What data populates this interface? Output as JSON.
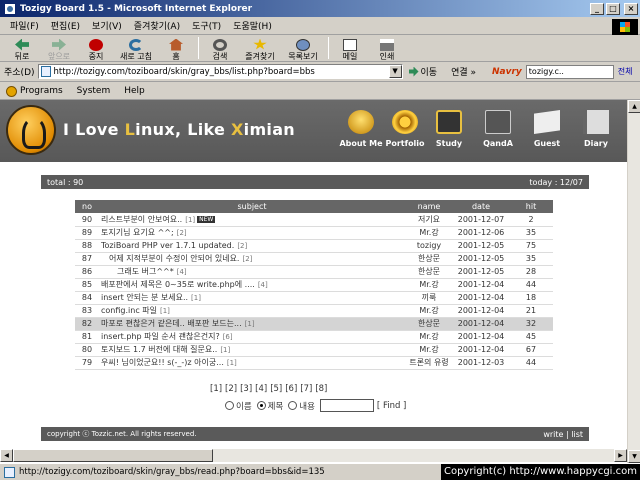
{
  "window": {
    "title": "Tozigy Board 1.5 - Microsoft Internet Explorer",
    "min": "_",
    "max": "□",
    "close": "×"
  },
  "menu": [
    "파일(F)",
    "편집(E)",
    "보기(V)",
    "즐겨찾기(A)",
    "도구(T)",
    "도움말(H)"
  ],
  "toolbar": {
    "back": "뒤로",
    "forward": "앞으로",
    "stop": "중지",
    "refresh": "새로 고침",
    "home": "홈",
    "search": "검색",
    "favorites": "즐겨찾기",
    "history": "목록보기",
    "mail": "메일",
    "print": "인쇄"
  },
  "address": {
    "label": "주소(D)",
    "url": "http://tozigy.com/toziboard/skin/gray_bbs/list.php?board=bbs",
    "go": "이동",
    "links": "연결 »",
    "naver_logo": "Navry",
    "naver_search": "tozigy.c..",
    "naver_all": "전체"
  },
  "linksbar": [
    "Programs",
    "System",
    "Help"
  ],
  "banner": {
    "title_parts": [
      "I Love ",
      "L",
      "inux, Like ",
      "X",
      "imian"
    ],
    "nav": [
      "About Me",
      "Portfolio",
      "Study",
      "QandA",
      "Guest",
      "Diary"
    ]
  },
  "board": {
    "total": "total : 90",
    "today": "today : 12/07",
    "headers": [
      "no",
      "subject",
      "name",
      "date",
      "hit"
    ],
    "rows": [
      {
        "no": "90",
        "subject": "리스트부분이 안보여요..",
        "cmt": "[1]",
        "new": "NEW",
        "name": "저기요",
        "date": "2001-12-07",
        "hit": "2"
      },
      {
        "no": "89",
        "subject": "토지기님 요기요 ^^;",
        "cmt": "[2]",
        "name": "Mr.강",
        "date": "2001-12-06",
        "hit": "35"
      },
      {
        "no": "88",
        "subject": "ToziBoard PHP ver 1.7.1 updated.",
        "cmt": "[2]",
        "name": "tozigy",
        "date": "2001-12-05",
        "hit": "75"
      },
      {
        "no": "87",
        "subject": "어제 지적부분이 수정이 안되어 있네요.",
        "cmt": "[2]",
        "indent": 1,
        "name": "한상문",
        "date": "2001-12-05",
        "hit": "35"
      },
      {
        "no": "86",
        "subject": "그래도 버그^^*",
        "cmt": "[4]",
        "indent": 2,
        "name": "한상문",
        "date": "2001-12-05",
        "hit": "28"
      },
      {
        "no": "85",
        "subject": "배포판에서 제목은 0~35로 write.php에 ....",
        "cmt": "[4]",
        "name": "Mr.강",
        "date": "2001-12-04",
        "hit": "44"
      },
      {
        "no": "84",
        "subject": "insert 안되는 분 보세요..",
        "cmt": "[1]",
        "name": "끼룩",
        "date": "2001-12-04",
        "hit": "18"
      },
      {
        "no": "83",
        "subject": "config.inc 파일",
        "cmt": "[1]",
        "name": "Mr.강",
        "date": "2001-12-04",
        "hit": "21"
      },
      {
        "no": "82",
        "subject": "마포로 편찮은거 같은데.. 배포판 보드는...",
        "cmt": "[1]",
        "name": "한상문",
        "date": "2001-12-04",
        "hit": "32",
        "selected": true
      },
      {
        "no": "81",
        "subject": "insert.php 파일 순서 괜찮은건지?",
        "cmt": "[6]",
        "name": "Mr.강",
        "date": "2001-12-04",
        "hit": "45"
      },
      {
        "no": "80",
        "subject": "토지보드 1.7 버전에 대해 질문요..",
        "cmt": "[1]",
        "name": "Mr.강",
        "date": "2001-12-04",
        "hit": "67"
      },
      {
        "no": "79",
        "subject": "우씨! 님이었군요!! s(-_-)z 아이궁...",
        "cmt": "[1]",
        "name": "트론의 유령",
        "date": "2001-12-03",
        "hit": "44"
      }
    ],
    "pages": [
      "[1]",
      "[2]",
      "[3]",
      "[4]",
      "[5]",
      "[6]",
      "[7]",
      "[8]"
    ],
    "search_opts": [
      "이름",
      "제목",
      "내용"
    ],
    "search_selected": 1,
    "find": "[ Find ]",
    "copyright": "copyright ⓒ Tozzic.net. All rights reserved.",
    "write": "write",
    "sep": "|",
    "list": "list"
  },
  "status": {
    "url": "http://tozigy.com/toziboard/skin/gray_bbs/read.php?board=bbs&id=135",
    "copyright": "Copyright(c) http://www.happycgi.com"
  }
}
